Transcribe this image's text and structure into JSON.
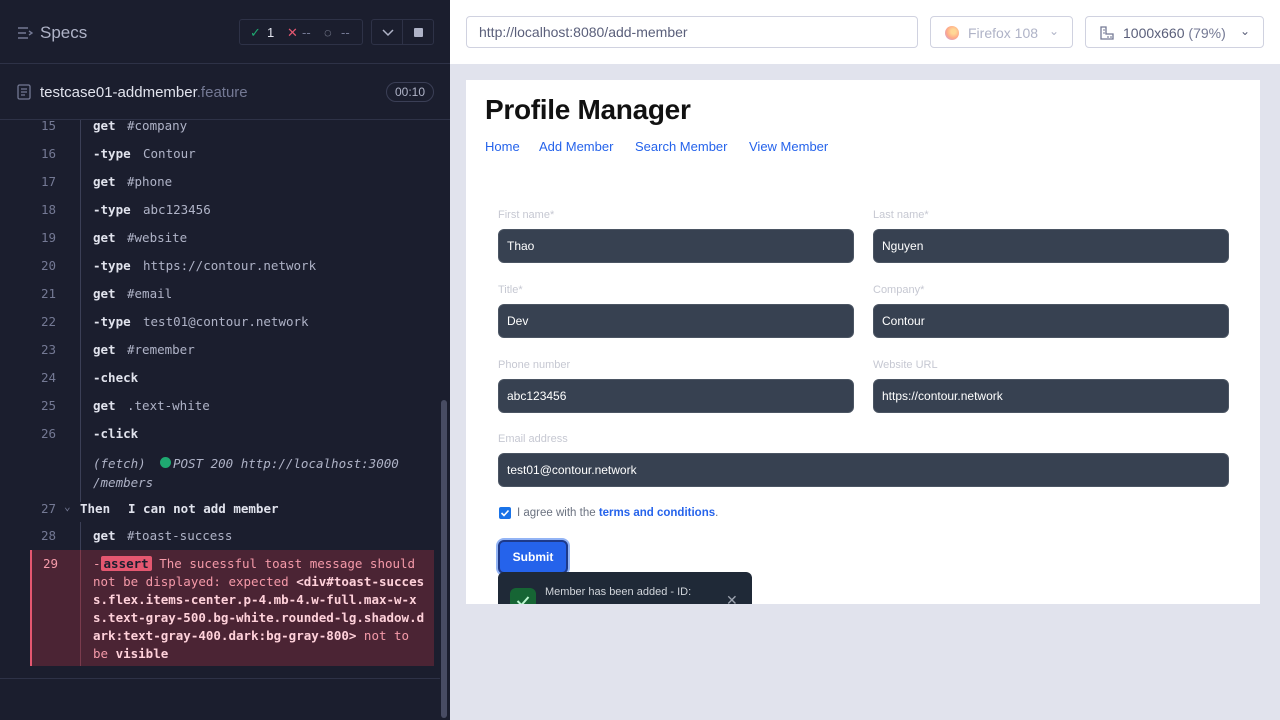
{
  "specs": {
    "title": "Specs",
    "passed": "1",
    "failed": "--",
    "pending": "--",
    "pass_icon": "✓",
    "fail_icon": "✕",
    "pending_icon": "◌"
  },
  "file": {
    "name": "testcase01-addmember",
    "ext": ".feature",
    "duration": "00:10"
  },
  "commands": [
    {
      "num": "15",
      "name": "get",
      "arg": "#company"
    },
    {
      "num": "16",
      "name": "-type",
      "arg": "Contour"
    },
    {
      "num": "17",
      "name": "get",
      "arg": "#phone"
    },
    {
      "num": "18",
      "name": "-type",
      "arg": "abc123456"
    },
    {
      "num": "19",
      "name": "get",
      "arg": "#website"
    },
    {
      "num": "20",
      "name": "-type",
      "arg": "https://contour.network"
    },
    {
      "num": "21",
      "name": "get",
      "arg": "#email"
    },
    {
      "num": "22",
      "name": "-type",
      "arg": "test01@contour.network"
    },
    {
      "num": "23",
      "name": "get",
      "arg": "#remember"
    },
    {
      "num": "24",
      "name": "-check",
      "arg": ""
    },
    {
      "num": "25",
      "name": "get",
      "arg": ".text-white"
    },
    {
      "num": "26",
      "name": "-click",
      "arg": ""
    }
  ],
  "fetch": {
    "label": "(fetch)",
    "request": "POST 200 http://localhost:3000",
    "request_cont": "/members"
  },
  "then": {
    "num": "27",
    "keyword": "Then",
    "text": "I can not add member"
  },
  "cmd28": {
    "num": "28",
    "name": "get",
    "arg": "#toast-success"
  },
  "assert": {
    "num": "29",
    "badge": "assert",
    "msg1": " The sucessful toast message should not be displayed: expected ",
    "element": "<div#toast-success.flex.items-center.p-4.mb-4.w-full.max-w-xs.text-gray-500.bg-white.rounded-lg.shadow.dark:text-gray-400.dark:bg-gray-800>",
    "msg2": " not to be ",
    "msg3": "visible"
  },
  "browser": {
    "url": "http://localhost:8080/add-member",
    "name": "Firefox 108",
    "viewport": "1000x660",
    "scale": "(79%)"
  },
  "app": {
    "title": "Profile Manager",
    "nav": [
      "Home",
      "Add Member",
      "Search Member",
      "View Member"
    ],
    "form": {
      "first_name": {
        "label": "First name*",
        "value": "Thao"
      },
      "last_name": {
        "label": "Last name*",
        "value": "Nguyen"
      },
      "title": {
        "label": "Title*",
        "value": "Dev"
      },
      "company": {
        "label": "Company*",
        "value": "Contour"
      },
      "phone": {
        "label": "Phone number",
        "value": "abc123456"
      },
      "website": {
        "label": "Website URL",
        "value": "https://contour.network"
      },
      "email": {
        "label": "Email address",
        "value": "test01@contour.network"
      },
      "agree_prefix": "I agree with the ",
      "agree_link": "terms and conditions",
      "agree_suffix": ".",
      "submit": "Submit"
    },
    "toast": {
      "message": "Member has been added - ID:",
      "close": "✕"
    }
  },
  "colors": {
    "runner_bg": "#1b1e2e",
    "pass": "#1fa971",
    "fail": "#e45770",
    "link": "#2563eb"
  }
}
